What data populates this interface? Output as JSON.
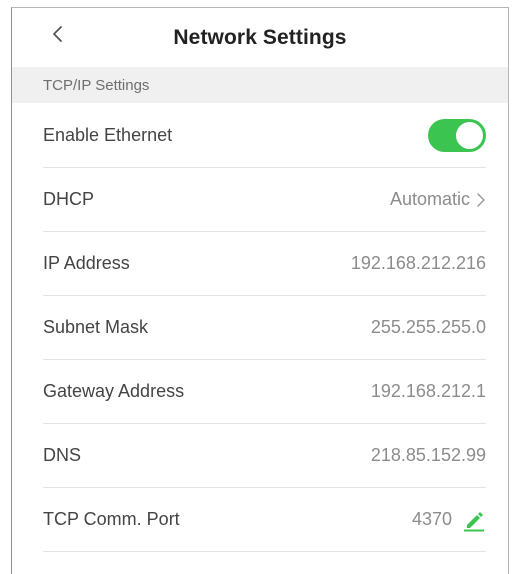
{
  "header": {
    "title": "Network Settings",
    "back_icon": "chevron-left-icon"
  },
  "section": {
    "title": "TCP/IP Settings"
  },
  "rows": {
    "ethernet": {
      "label": "Enable Ethernet",
      "enabled": true
    },
    "dhcp": {
      "label": "DHCP",
      "value": "Automatic",
      "icon": "chevron-right-icon"
    },
    "ip": {
      "label": "IP Address",
      "value": "192.168.212.216"
    },
    "subnet": {
      "label": "Subnet Mask",
      "value": "255.255.255.0"
    },
    "gateway": {
      "label": "Gateway Address",
      "value": "192.168.212.1"
    },
    "dns": {
      "label": "DNS",
      "value": "218.85.152.99"
    },
    "port": {
      "label": "TCP Comm. Port",
      "value": "4370",
      "icon": "edit-pencil-icon"
    }
  },
  "colors": {
    "accent": "#3cc451",
    "section_bg": "#f0f0f0",
    "value_text": "#8c8c8c"
  }
}
